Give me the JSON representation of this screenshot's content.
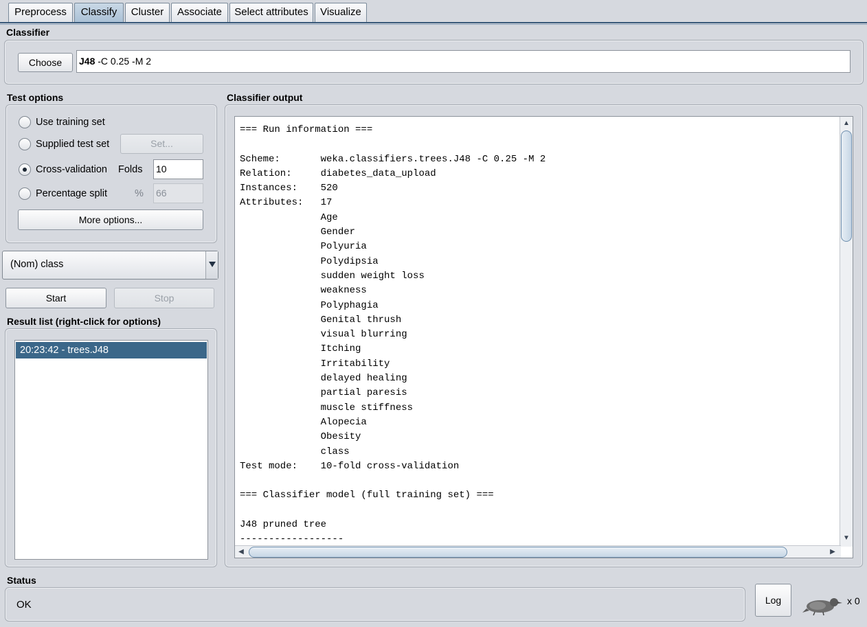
{
  "tabs": [
    {
      "label": "Preprocess",
      "active": false
    },
    {
      "label": "Classify",
      "active": true
    },
    {
      "label": "Cluster",
      "active": false
    },
    {
      "label": "Associate",
      "active": false
    },
    {
      "label": "Select attributes",
      "active": false
    },
    {
      "label": "Visualize",
      "active": false
    }
  ],
  "classifier": {
    "section_title": "Classifier",
    "choose_label": "Choose",
    "name_bold": "J48",
    "options": " -C 0.25 -M 2"
  },
  "test_options": {
    "section_title": "Test options",
    "use_training_set": "Use training set",
    "supplied_test_set": "Supplied test set",
    "set_button": "Set...",
    "cross_validation": "Cross-validation",
    "folds_label": "Folds",
    "folds_value": "10",
    "percentage_split": "Percentage split",
    "percent_symbol": "%",
    "percent_value": "66",
    "more_options": "More options...",
    "selected": "cross-validation"
  },
  "class_select": {
    "value": "(Nom) class"
  },
  "run": {
    "start_label": "Start",
    "stop_label": "Stop"
  },
  "result_list": {
    "section_title": "Result list (right-click for options)",
    "items": [
      {
        "label": "20:23:42 - trees.J48",
        "selected": true
      }
    ]
  },
  "output": {
    "section_title": "Classifier output",
    "text": "=== Run information ===\n\nScheme:       weka.classifiers.trees.J48 -C 0.25 -M 2\nRelation:     diabetes_data_upload\nInstances:    520\nAttributes:   17\n              Age\n              Gender\n              Polyuria\n              Polydipsia\n              sudden weight loss\n              weakness\n              Polyphagia\n              Genital thrush\n              visual blurring\n              Itching\n              Irritability\n              delayed healing\n              partial paresis\n              muscle stiffness\n              Alopecia\n              Obesity\n              class\nTest mode:    10-fold cross-validation\n\n=== Classifier model (full training set) ===\n\nJ48 pruned tree\n------------------"
  },
  "status": {
    "section_title": "Status",
    "text": "OK",
    "log_label": "Log",
    "task_count": "x 0"
  },
  "icons": {
    "weka_bird": "weka-bird-icon",
    "combo_arrow": "chevron-down-icon"
  },
  "colors": {
    "selection": "#3b6789",
    "active_tab": "#a9c0d5"
  }
}
